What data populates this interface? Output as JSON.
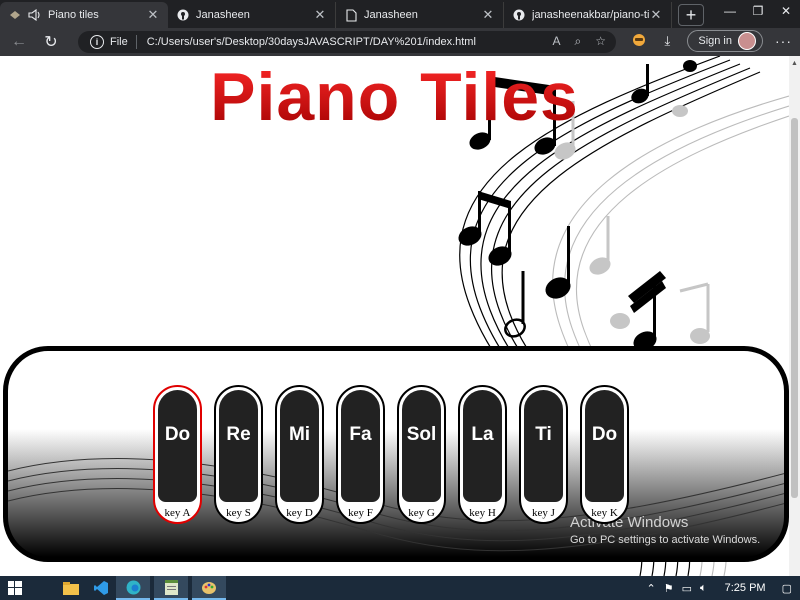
{
  "browser": {
    "tabs": [
      {
        "title": "Piano tiles",
        "active": true,
        "favicon": "piano-favicon"
      },
      {
        "title": "Janasheen",
        "active": false,
        "favicon": "github-favicon"
      },
      {
        "title": "Janasheen",
        "active": false,
        "favicon": "page-favicon"
      },
      {
        "title": "janasheenakbar/piano-tiles",
        "active": false,
        "favicon": "github-favicon"
      }
    ],
    "new_tab_label": "+",
    "address": {
      "scheme_label": "File",
      "url": "C:/Users/user's/Desktop/30daysJAVASCRIPT/DAY%201/index.html"
    },
    "sign_in_label": "Sign in"
  },
  "page": {
    "heading": "Piano Tiles",
    "keys": [
      {
        "note": "Do",
        "label": "key A",
        "active": true
      },
      {
        "note": "Re",
        "label": "key S",
        "active": false
      },
      {
        "note": "Mi",
        "label": "key D",
        "active": false
      },
      {
        "note": "Fa",
        "label": "key F",
        "active": false
      },
      {
        "note": "Sol",
        "label": "key G",
        "active": false
      },
      {
        "note": "La",
        "label": "key H",
        "active": false
      },
      {
        "note": "Ti",
        "label": "key J",
        "active": false
      },
      {
        "note": "Do",
        "label": "key K",
        "active": false
      }
    ]
  },
  "watermark": {
    "title": "Activate Windows",
    "subtitle": "Go to PC settings to activate Windows."
  },
  "taskbar": {
    "time": "7:25 PM"
  },
  "colors": {
    "heading_red": "#c00006",
    "active_key_border": "#e00000",
    "tab_bg": "#202124",
    "taskbar_bg": "#1b2a3a"
  }
}
